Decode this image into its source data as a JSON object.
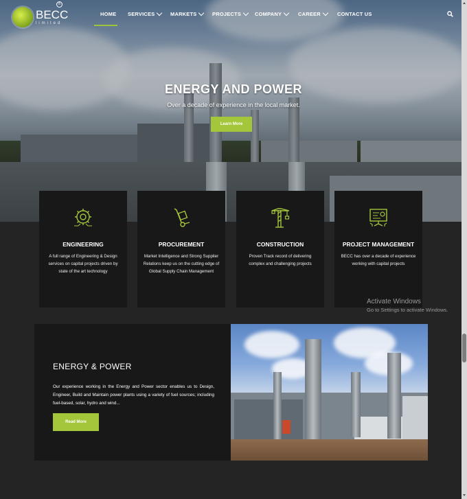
{
  "brand": {
    "name": "BECC",
    "sub": "limited",
    "sup": "®"
  },
  "nav": {
    "items": [
      {
        "label": "HOME",
        "dropdown": false
      },
      {
        "label": "SERVICES",
        "dropdown": true
      },
      {
        "label": "MARKETS",
        "dropdown": true
      },
      {
        "label": "PROJECTS",
        "dropdown": true
      },
      {
        "label": "COMPANY",
        "dropdown": true
      },
      {
        "label": "CAREER",
        "dropdown": true
      },
      {
        "label": "CONTACT US",
        "dropdown": false
      }
    ],
    "active": "HOME"
  },
  "hero": {
    "title": "ENERGY AND POWER",
    "subtitle": "Over a decade of experience in the local market.",
    "button": "Learn More"
  },
  "services": [
    {
      "icon": "gear-circuit-icon",
      "title": "ENGINEERING",
      "desc": "A full range of Engineering & Design services on capital projects driven by state of the art technology"
    },
    {
      "icon": "hand-truck-icon",
      "title": "PROCUREMENT",
      "desc": "Market Intelligence and Strong Supplier Relations keep us on the cutting edge of Global Supply Chain Management"
    },
    {
      "icon": "crane-icon",
      "title": "CONSTRUCTION",
      "desc": "Proven Track record of delivering complex and challenging projects"
    },
    {
      "icon": "presentation-icon",
      "title": "PROJECT MANAGEMENT",
      "desc": "BECC has over a decade of experience working with capital projects"
    }
  ],
  "activation": {
    "title": "Activate Windows",
    "sub": "Go to Settings to activate Windows."
  },
  "energy": {
    "title": "ENERGY & POWER",
    "desc": "Our experience working in the Energy and Power sector enables us to Design, Engineer, Build and Maintain power plants using a variety of fuel sources; including fuel-based, solar, hydro and wind...",
    "button": "Read More"
  },
  "colors": {
    "accent": "#a4c63b",
    "card": "#181818",
    "background": "#242424"
  }
}
